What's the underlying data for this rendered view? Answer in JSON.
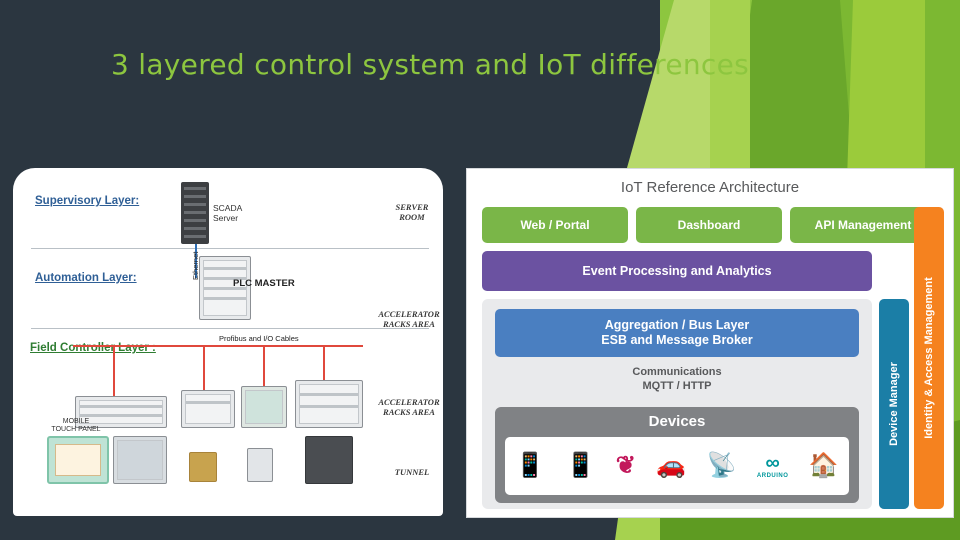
{
  "slide": {
    "title": "3 layered control system and IoT differences",
    "title_color": "#8dc63f",
    "background_color": "#2b3640",
    "accent_color": "#8dc63f"
  },
  "left_figure": {
    "name": "3-layered control system diagram",
    "layers": [
      {
        "label": "Supervisory Layer:",
        "color": "#2f5f96"
      },
      {
        "label": "Automation Layer:",
        "color": "#2f5f96"
      },
      {
        "label": "Field Controller Layer :",
        "color": "#2f7d32"
      }
    ],
    "annotations": [
      {
        "label": "SCADA\nServer"
      },
      {
        "label": "SERVER\nROOM"
      },
      {
        "label": "Ethernet"
      },
      {
        "label": "PLC MASTER"
      },
      {
        "label": "ACCELERATOR\nRACKS AREA"
      },
      {
        "label": "Profibus and I/O Cables"
      },
      {
        "label": "ACCELERATOR\nRACKS AREA"
      },
      {
        "label": "MOBILE\nTOUCH PANEL"
      },
      {
        "label": "TUNNEL"
      }
    ],
    "texts": {
      "scada_server": "SCADA\nServer",
      "server_room": "SERVER\nROOM",
      "ethernet": "Ethernet",
      "plc_master": "PLC MASTER",
      "racks_area_top": "ACCELERATOR\nRACKS AREA",
      "profibus": "Profibus and I/O Cables",
      "racks_area_bottom": "ACCELERATOR\nRACKS AREA",
      "mobile_panel": "MOBILE\nTOUCH PANEL",
      "tunnel": "TUNNEL"
    }
  },
  "right_figure": {
    "title": "IoT Reference Architecture",
    "top_row": [
      {
        "label": "Web / Portal",
        "color": "#7ab648"
      },
      {
        "label": "Dashboard",
        "color": "#7ab648"
      },
      {
        "label": "API Management",
        "color": "#7ab648"
      }
    ],
    "event_layer": {
      "label": "Event Processing and Analytics",
      "color": "#6b52a1"
    },
    "aggregation": {
      "label": "Aggregation / Bus Layer\nESB and Message Broker",
      "line1": "Aggregation / Bus Layer",
      "line2": "ESB and Message Broker",
      "color": "#4a7fc1"
    },
    "communications": {
      "line1": "Communications",
      "line2": "MQTT / HTTP",
      "color": "#58595b"
    },
    "devices": {
      "label": "Devices",
      "color": "#808285"
    },
    "device_icons": [
      "feature-phone-icon",
      "smartphone-icon",
      "raspberry-pi-icon",
      "car-icon",
      "wireless-sensor-icon",
      "arduino-icon",
      "smart-home-icon"
    ],
    "device_icon_glyphs": [
      "📱",
      "📱",
      "🍓",
      "🚗",
      "📡",
      "∞",
      "🏠"
    ],
    "right_columns": [
      {
        "label": "Device Manager",
        "color": "#1b7ea6"
      },
      {
        "label": "Identity & Access Management",
        "color": "#f5821f"
      }
    ],
    "arduino_label": "ARDUINO"
  }
}
